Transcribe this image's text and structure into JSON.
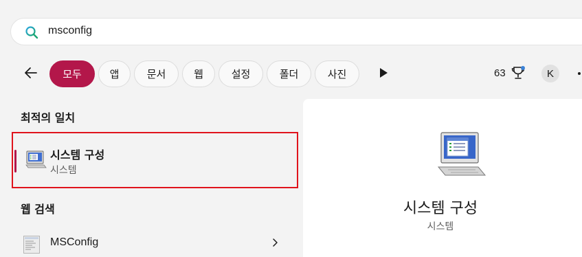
{
  "search": {
    "query": "msconfig"
  },
  "filters": [
    {
      "label": "모두",
      "active": true
    },
    {
      "label": "앱"
    },
    {
      "label": "문서"
    },
    {
      "label": "웹"
    },
    {
      "label": "설정"
    },
    {
      "label": "폴더"
    },
    {
      "label": "사진"
    }
  ],
  "header_right": {
    "points": "63",
    "avatar_initial": "K"
  },
  "best_match": {
    "section_title": "최적의 일치",
    "title": "시스템 구성",
    "subtitle": "시스템",
    "icon": "system-configuration-icon"
  },
  "web_search": {
    "section_title": "웹 검색",
    "items": [
      {
        "label": "MSConfig",
        "icon": "msconfig-thumbnail-icon"
      }
    ]
  },
  "detail": {
    "title": "시스템 구성",
    "subtitle": "시스템"
  },
  "colors": {
    "accent": "#b3174a",
    "highlight_border": "#e0131c"
  }
}
